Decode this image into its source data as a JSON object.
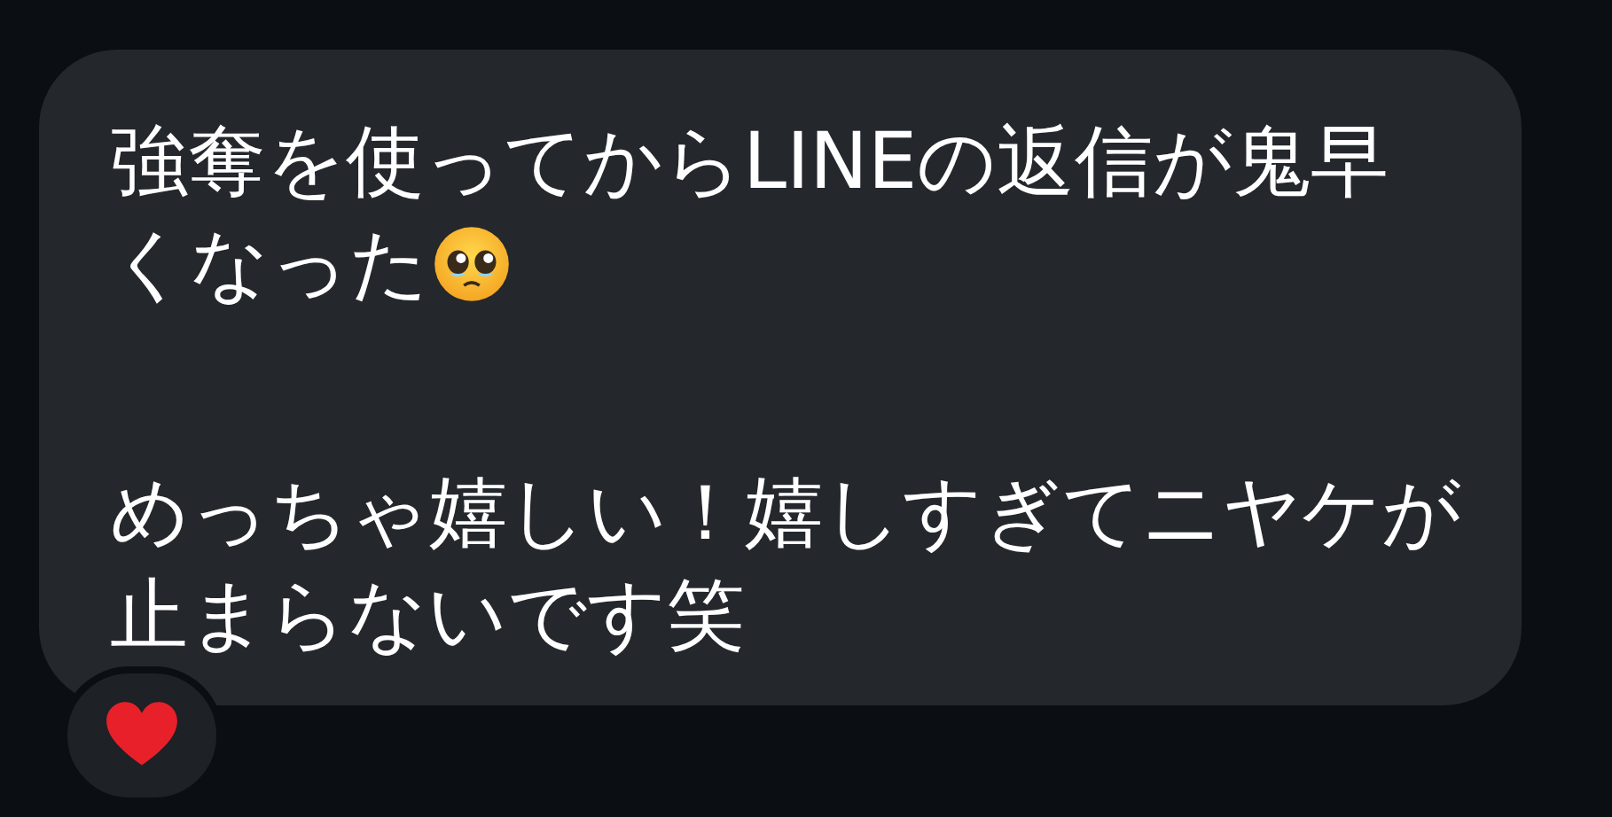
{
  "message": {
    "paragraphs": [
      {
        "lines": [
          {
            "kind": "text",
            "text": "強奪を使ってからLINEの返信が鬼早"
          },
          {
            "kind": "text_with_emoji",
            "text": "くなった"
          }
        ]
      },
      {
        "lines": [
          {
            "kind": "text",
            "text": "めっちゃ嬉しい！嬉しすぎてニヤケが"
          },
          {
            "kind": "text",
            "text": "止まらないです笑"
          }
        ]
      }
    ]
  },
  "reaction": {
    "kind": "heart"
  }
}
